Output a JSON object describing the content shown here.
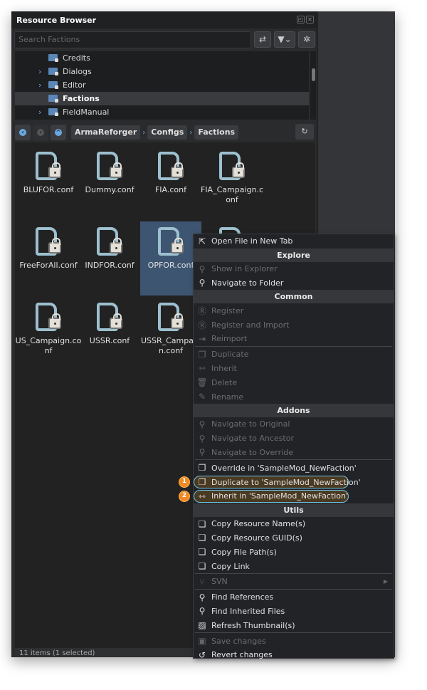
{
  "window": {
    "title": "Resource Browser"
  },
  "search": {
    "placeholder": "Search Factions"
  },
  "toolbar": {
    "swap_icon": "swap-icon",
    "filter_icon": "filter-icon",
    "settings_icon": "gear-icon"
  },
  "tree": {
    "items": [
      {
        "label": "Credits",
        "expandable": false,
        "selected": false
      },
      {
        "label": "Dialogs",
        "expandable": true,
        "selected": false
      },
      {
        "label": "Editor",
        "expandable": true,
        "selected": false
      },
      {
        "label": "Factions",
        "expandable": false,
        "selected": true
      },
      {
        "label": "FieldManual",
        "expandable": true,
        "selected": false
      }
    ]
  },
  "breadcrumb": [
    "ArmaReforger",
    "Configs",
    "Factions"
  ],
  "files": [
    {
      "name": "BLUFOR.conf"
    },
    {
      "name": "Dummy.conf"
    },
    {
      "name": "FIA.conf"
    },
    {
      "name": "FIA_Campaign.conf"
    },
    {
      "name": "FreeForAll.conf"
    },
    {
      "name": "INDFOR.conf"
    },
    {
      "name": "OPFOR.conf",
      "selected": true
    },
    {
      "name": ""
    },
    {
      "name": "US_Campaign.conf"
    },
    {
      "name": "USSR.conf"
    },
    {
      "name": "USSR_Campaign.conf"
    }
  ],
  "status": "11 items (1 selected)",
  "menu": [
    {
      "t": "item",
      "label": "Open File in New Tab",
      "icon": "external-link-icon",
      "g": "⇱"
    },
    {
      "t": "header",
      "label": "Explore"
    },
    {
      "t": "item",
      "label": "Show in Explorer",
      "icon": "search-icon",
      "g": "⚲",
      "disabled": true
    },
    {
      "t": "item",
      "label": "Navigate to Folder",
      "icon": "search-icon",
      "g": "⚲"
    },
    {
      "t": "header",
      "label": "Common"
    },
    {
      "t": "item",
      "label": "Register",
      "icon": "register-icon",
      "g": "Ⓡ",
      "disabled": true
    },
    {
      "t": "item",
      "label": "Register and Import",
      "icon": "register-icon",
      "g": "Ⓡ",
      "disabled": true
    },
    {
      "t": "item",
      "label": "Reimport",
      "icon": "reimport-icon",
      "g": "⇥",
      "disabled": true
    },
    {
      "t": "sep"
    },
    {
      "t": "item",
      "label": "Duplicate",
      "icon": "duplicate-icon",
      "g": "❐",
      "disabled": true
    },
    {
      "t": "item",
      "label": "Inherit",
      "icon": "inherit-icon",
      "g": "⇿",
      "disabled": true
    },
    {
      "t": "item",
      "label": "Delete",
      "icon": "trash-icon",
      "g": "🗑",
      "disabled": true
    },
    {
      "t": "item",
      "label": "Rename",
      "icon": "pencil-icon",
      "g": "✎",
      "disabled": true
    },
    {
      "t": "header",
      "label": "Addons"
    },
    {
      "t": "item",
      "label": "Navigate to Original",
      "icon": "search-icon",
      "g": "⚲",
      "disabled": true
    },
    {
      "t": "item",
      "label": "Navigate to Ancestor",
      "icon": "search-icon",
      "g": "⚲",
      "disabled": true
    },
    {
      "t": "item",
      "label": "Navigate to Override",
      "icon": "search-icon",
      "g": "⚲",
      "disabled": true
    },
    {
      "t": "sep"
    },
    {
      "t": "item",
      "label": "Override in 'SampleMod_NewFaction'",
      "icon": "duplicate-icon",
      "g": "❐"
    },
    {
      "t": "item",
      "label": "Duplicate to 'SampleMod_NewFaction'",
      "icon": "duplicate-icon",
      "g": "❐",
      "badge": "1"
    },
    {
      "t": "item",
      "label": "Inherit in 'SampleMod_NewFaction'",
      "icon": "inherit-icon",
      "g": "⇿",
      "badge": "2"
    },
    {
      "t": "header",
      "label": "Utils"
    },
    {
      "t": "item",
      "label": "Copy Resource Name(s)",
      "icon": "copy-icon",
      "g": "❏"
    },
    {
      "t": "item",
      "label": "Copy Resource GUID(s)",
      "icon": "copy-icon",
      "g": "❏"
    },
    {
      "t": "item",
      "label": "Copy File Path(s)",
      "icon": "copy-icon",
      "g": "❏"
    },
    {
      "t": "item",
      "label": "Copy Link",
      "icon": "copy-icon",
      "g": "❏"
    },
    {
      "t": "sep"
    },
    {
      "t": "item",
      "label": "SVN",
      "icon": "branch-icon",
      "g": "⑂",
      "disabled": true,
      "submenu": true
    },
    {
      "t": "sep"
    },
    {
      "t": "item",
      "label": "Find References",
      "icon": "search-icon",
      "g": "⚲"
    },
    {
      "t": "item",
      "label": "Find Inherited Files",
      "icon": "search-icon",
      "g": "⚲"
    },
    {
      "t": "item",
      "label": "Refresh Thumbnail(s)",
      "icon": "image-icon",
      "g": "▨"
    },
    {
      "t": "sep"
    },
    {
      "t": "item",
      "label": "Save changes",
      "icon": "save-icon",
      "g": "▣",
      "disabled": true
    },
    {
      "t": "item",
      "label": "Revert changes",
      "icon": "history-icon",
      "g": "↺"
    }
  ]
}
